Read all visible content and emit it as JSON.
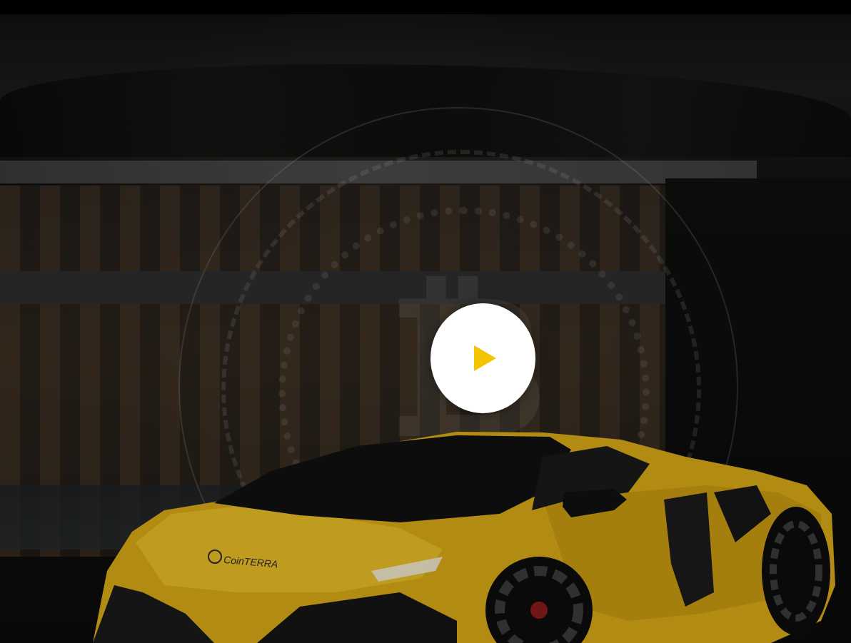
{
  "video": {
    "play_icon": "play-icon",
    "play_color": "#f5c400",
    "button_color": "#ffffff"
  },
  "car": {
    "logo_text": "CoinTERRA",
    "body_color": "#e0b21a"
  },
  "background": {
    "symbol": "₿"
  }
}
